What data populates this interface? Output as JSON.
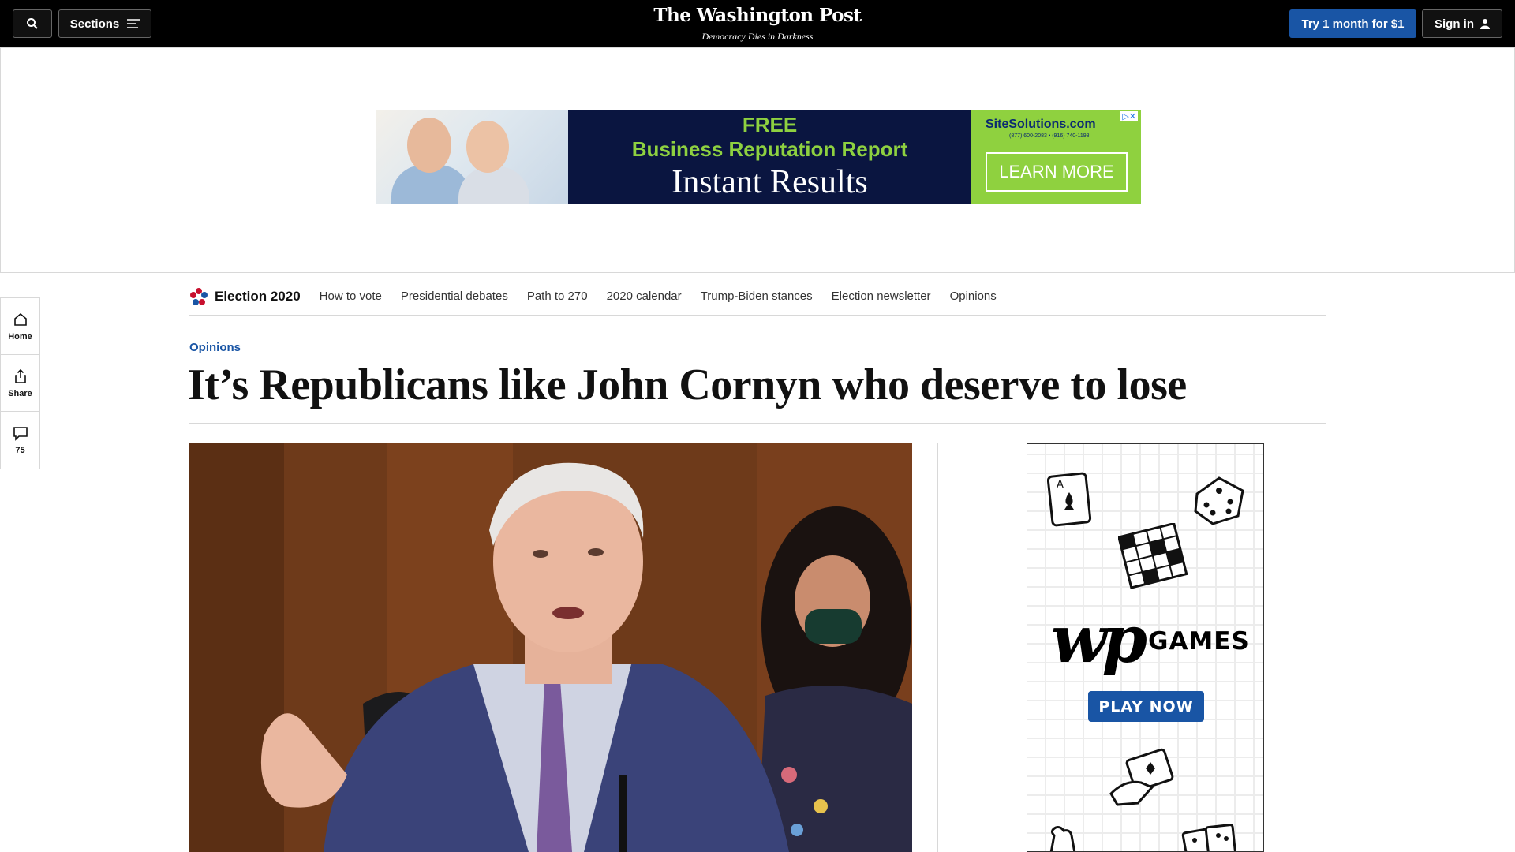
{
  "header": {
    "sections_label": "Sections",
    "logo": "The Washington Post",
    "tagline": "Democracy Dies in Darkness",
    "try_label": "Try 1 month for $1",
    "signin_label": "Sign in"
  },
  "ad_banner": {
    "line1": "FREE",
    "line2": "Business Reputation Report",
    "line3": "Instant Results",
    "brand": "SiteSolutions.com",
    "phone": "(877) 600-2083 • (916) 740-1198",
    "cta": "LEARN MORE"
  },
  "rail": {
    "home_label": "Home",
    "share_label": "Share",
    "comments_count": "75"
  },
  "subnav": {
    "brand": "Election 2020",
    "links": [
      "How to vote",
      "Presidential debates",
      "Path to 270",
      "2020 calendar",
      "Trump-Biden stances",
      "Election newsletter",
      "Opinions"
    ]
  },
  "article": {
    "kicker": "Opinions",
    "headline": "It’s Republicans like John Cornyn who deserve to lose"
  },
  "games_ad": {
    "brand": "wp",
    "label": "GAMES",
    "cta": "PLAY NOW"
  },
  "colors": {
    "accent": "#1955a5",
    "header_bg": "#000000",
    "ad_green": "#8ed140"
  }
}
